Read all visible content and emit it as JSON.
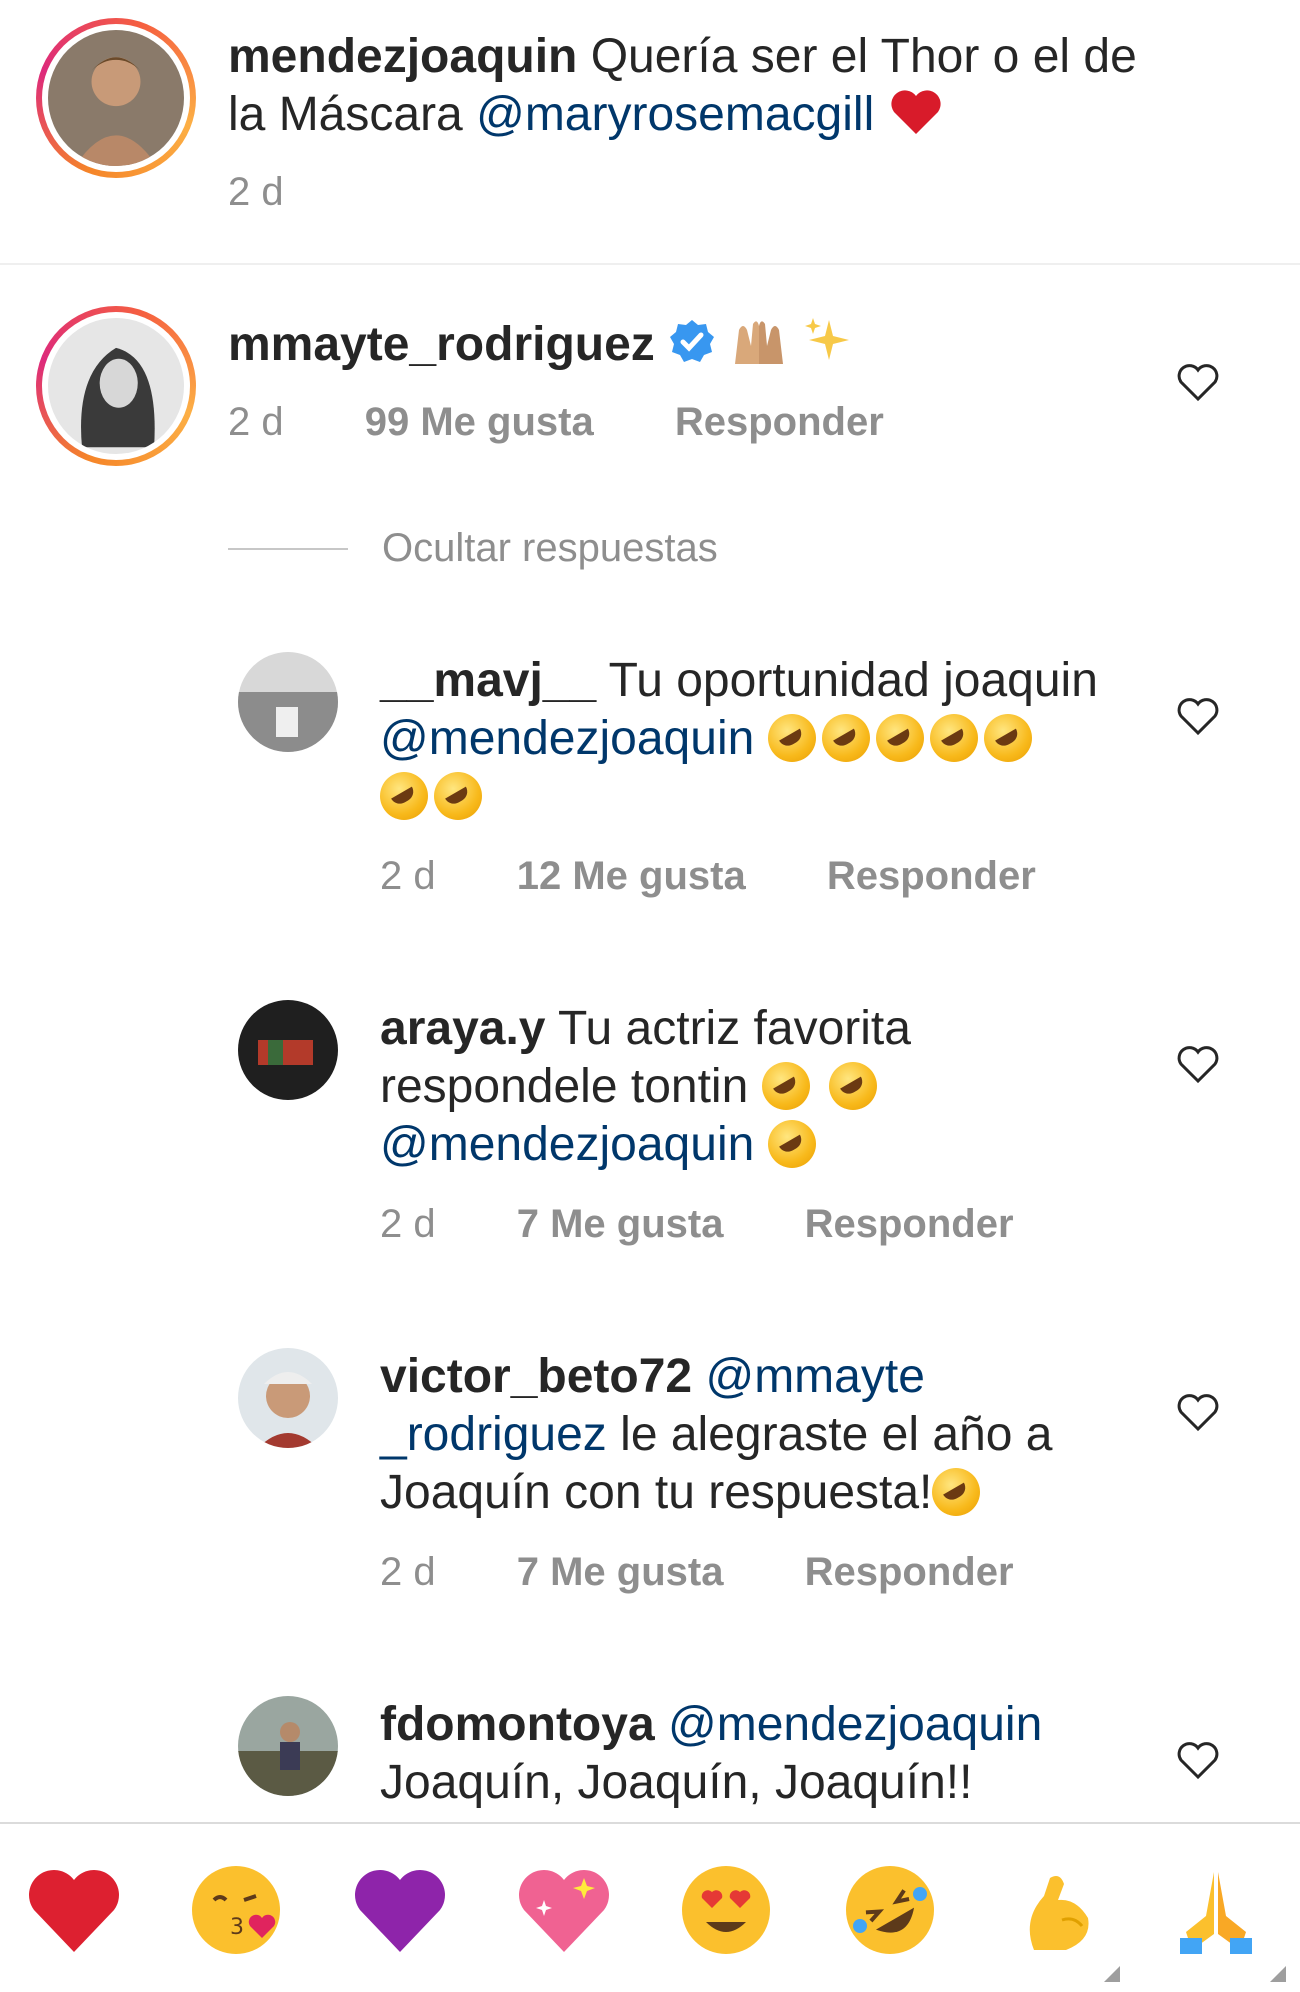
{
  "caption": {
    "username": "mendezjoaquin",
    "text": "Quería ser el Thor o el de",
    "text2": "la Máscara",
    "mention": "@maryrosemacgill",
    "time": "2 d"
  },
  "comments": [
    {
      "username": "mmayte_rodriguez",
      "time": "2 d",
      "likes": "99 Me gusta",
      "reply": "Responder"
    }
  ],
  "hide_replies": "Ocultar respuestas",
  "replies": [
    {
      "username": "__mavj__",
      "text": "Tu oportunidad joaquin",
      "mention": "@mendezjoaquin",
      "time": "2 d",
      "likes": "12 Me gusta",
      "reply": "Responder"
    },
    {
      "username": "araya.y",
      "text": "Tu actriz favorita",
      "text2": "respondele tontin",
      "mention": "@mendezjoaquin",
      "time": "2 d",
      "likes": "7 Me gusta",
      "reply": "Responder"
    },
    {
      "username": "victor_beto72",
      "mention": "@mmayte",
      "mention2": "_rodriguez",
      "text": "le  alegraste el año a",
      "text2": "Joaquín con tu respuesta!",
      "time": "2 d",
      "likes": "7 Me gusta",
      "reply": "Responder"
    },
    {
      "username": "fdomontoya",
      "mention": "@mendezjoaquin",
      "text": "Joaquín, Joaquín, Joaquín!!"
    }
  ],
  "reaction_bar": [
    "red-heart",
    "kissing-heart-face",
    "purple-heart",
    "sparkling-heart",
    "heart-eyes-face",
    "rolling-laughing-face",
    "flexed-biceps",
    "folded-hands"
  ],
  "colors": {
    "mention": "#00376b",
    "meta": "#8e8e8e",
    "verified": "#3897f0"
  }
}
